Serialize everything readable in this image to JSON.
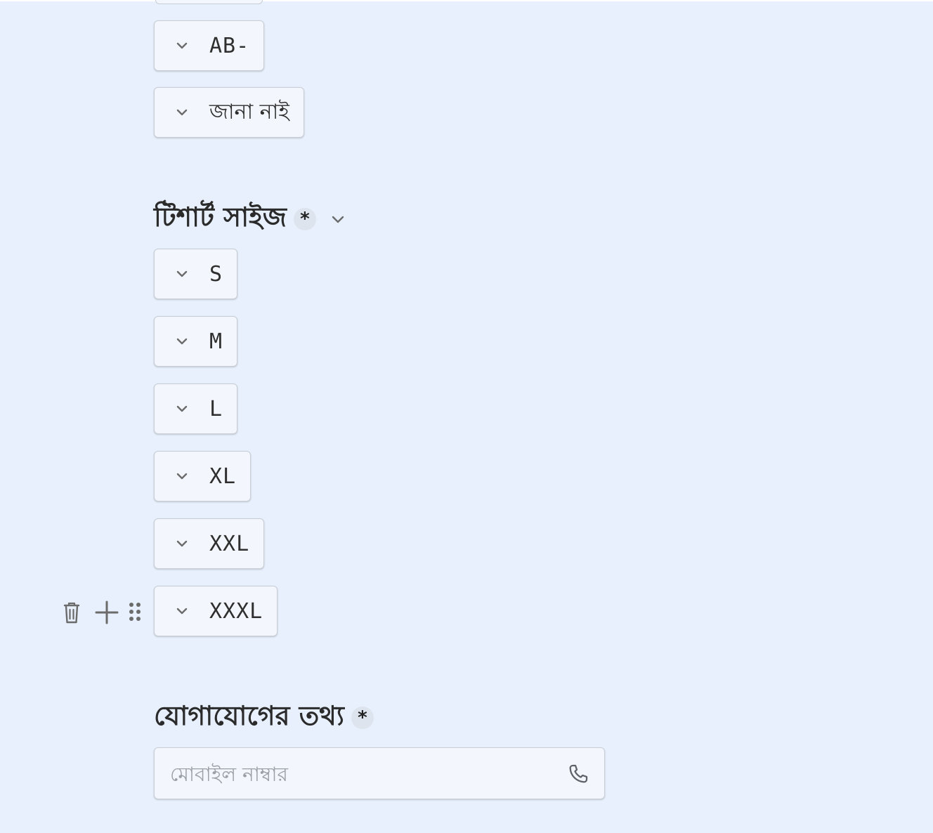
{
  "blood_group_options": [
    {
      "label": "AB-"
    },
    {
      "label": "জানা নাই"
    }
  ],
  "tshirt_section": {
    "title": "টিশার্ট সাইজ",
    "required_mark": "*",
    "options": [
      {
        "label": "S"
      },
      {
        "label": "M"
      },
      {
        "label": "L"
      },
      {
        "label": "XL"
      },
      {
        "label": "XXL"
      },
      {
        "label": "XXXL"
      }
    ]
  },
  "contact_section": {
    "title": "যোগাযোগের তথ্য",
    "required_mark": "*",
    "phone_placeholder": "মোবাইল নাম্বার",
    "phone_value": ""
  },
  "icons": {
    "option_expand": "chevron-down-icon",
    "section_collapse": "chevron-down-icon",
    "delete": "trash-icon",
    "add": "plus-icon",
    "drag": "drag-handle-icon",
    "phone": "phone-icon"
  },
  "colors": {
    "background": "#e7f0fc",
    "chip_background": "#f3f7fd",
    "chip_border": "#c9ced6",
    "text": "#2b2b2b",
    "icon": "#6b6b6b"
  }
}
